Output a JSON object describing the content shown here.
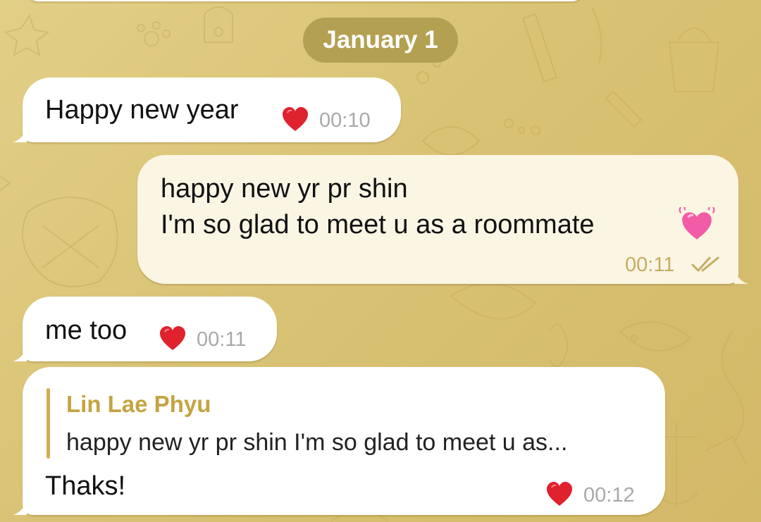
{
  "chat": {
    "date_separator": "January 1",
    "messages": [
      {
        "direction": "incoming",
        "text_lines": [
          "Happy new year"
        ],
        "reaction": "heart-icon",
        "time": "00:10"
      },
      {
        "direction": "outgoing",
        "text_lines": [
          "happy new yr pr shin",
          "I'm so glad to meet u as a roommate"
        ],
        "emoji": "sparkling-heart-emoji",
        "time": "00:11",
        "status": "read-double-check-icon"
      },
      {
        "direction": "incoming",
        "text_lines": [
          "me too"
        ],
        "reaction": "heart-icon",
        "time": "00:11"
      },
      {
        "direction": "incoming",
        "reply": {
          "sender": "Lin Lae Phyu",
          "preview": "happy new yr pr shin I'm so glad to meet u as..."
        },
        "text_lines": [
          "Thaks!"
        ],
        "reaction": "heart-icon",
        "time": "00:12"
      }
    ]
  },
  "colors": {
    "wallpaper": "#d9c274",
    "incoming_bubble": "#ffffff",
    "outgoing_bubble": "#fbf5e4",
    "date_pill": "#b09c4e",
    "reply_accent": "#c4a443",
    "outgoing_meta": "#c6ad63",
    "incoming_meta": "#a9a9a9",
    "heart": "#e0212e"
  }
}
